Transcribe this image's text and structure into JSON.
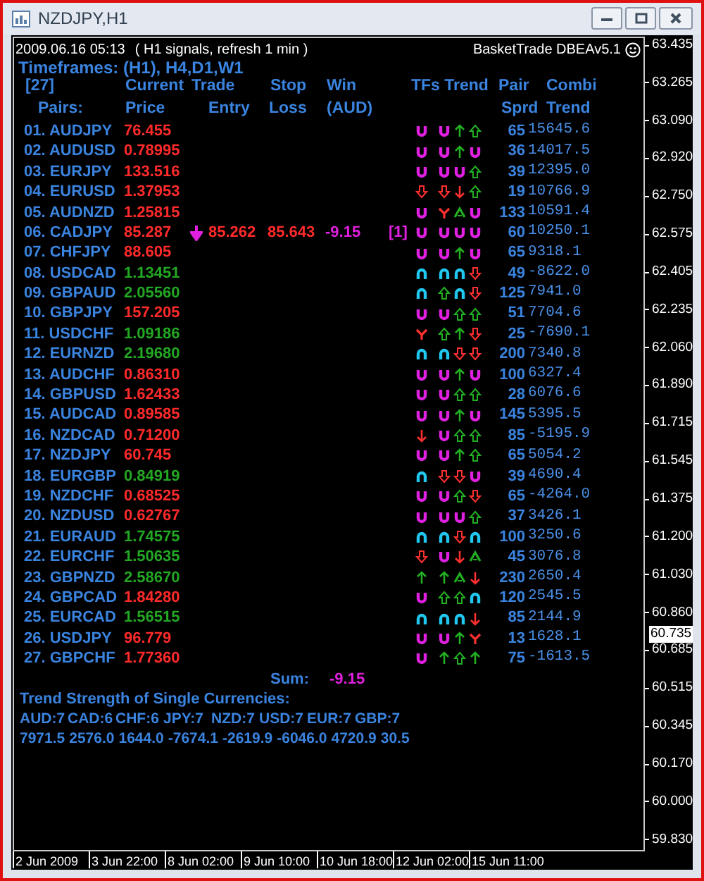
{
  "window": {
    "title": "NZDJPY,H1"
  },
  "chart": {
    "timestamp": "2009.06.16 05:13",
    "info": "( H1 signals, refresh 1 min )",
    "ea_name": "BasketTrade DBEAv5.1",
    "timeframes": "Timeframes: (H1), H4,D1,W1",
    "columns": [
      {
        "top": "[27]",
        "bottom": "Pairs:"
      },
      {
        "top": "Current",
        "bottom": "Price"
      },
      {
        "top": "Trade",
        "bottom": "Entry"
      },
      {
        "top": "Stop",
        "bottom": "Loss"
      },
      {
        "top": "Win",
        "bottom": "(AUD)"
      },
      {
        "top": "TFs Trend"
      },
      {
        "top": "Pair",
        "bottom": "Sprd"
      },
      {
        "top": "Combi",
        "bottom": "Trend"
      }
    ],
    "pairs": [
      {
        "label": "01. AUDJPY",
        "price": "76.455",
        "color": "#ff2a2a",
        "tf": {
          "kind": "cup"
        },
        "trend": [
          {
            "kind": "cup"
          },
          {
            "kind": "up"
          },
          {
            "kind": "hollowup"
          }
        ],
        "spread": "65",
        "combi": "15645.6"
      },
      {
        "label": "02. AUDUSD",
        "price": "0.78995",
        "color": "#ff2a2a",
        "tf": {
          "kind": "cup"
        },
        "trend": [
          {
            "kind": "cup"
          },
          {
            "kind": "up"
          },
          {
            "kind": "cup"
          }
        ],
        "spread": "36",
        "combi": "14017.5"
      },
      {
        "label": "03. EURJPY",
        "price": "133.516",
        "color": "#ff2a2a",
        "tf": {
          "kind": "cup"
        },
        "trend": [
          {
            "kind": "cup"
          },
          {
            "kind": "cup"
          },
          {
            "kind": "hollowup"
          }
        ],
        "spread": "39",
        "combi": "12395.0"
      },
      {
        "label": "04. EURUSD",
        "price": "1.37953",
        "color": "#ff2a2a",
        "tf": {
          "kind": "hollowdown"
        },
        "trend": [
          {
            "kind": "hollowdown"
          },
          {
            "kind": "down"
          },
          {
            "kind": "hollowup"
          }
        ],
        "spread": "19",
        "combi": "10766.9"
      },
      {
        "label": "05. AUDNZD",
        "price": "1.25815",
        "color": "#ff2a2a",
        "tf": {
          "kind": "cup"
        },
        "trend": [
          {
            "kind": "fork"
          },
          {
            "kind": "chevron"
          },
          {
            "kind": "cup"
          }
        ],
        "spread": "133",
        "combi": "10591.4"
      },
      {
        "label": "06. CADJPY",
        "price": "85.287",
        "color": "#ff2a2a",
        "trade": {
          "kind": "sell",
          "entry": "85.262",
          "stop": "85.643",
          "win": "-9.15",
          "count": "[1]"
        },
        "tf": {
          "kind": "cup"
        },
        "trend": [
          {
            "kind": "cup"
          },
          {
            "kind": "cup"
          },
          {
            "kind": "cup"
          }
        ],
        "spread": "60",
        "combi": "10250.1"
      },
      {
        "label": "07. CHFJPY",
        "price": "88.605",
        "color": "#ff2a2a",
        "tf": {
          "kind": "cup"
        },
        "trend": [
          {
            "kind": "cup"
          },
          {
            "kind": "up"
          },
          {
            "kind": "cup"
          }
        ],
        "spread": "65",
        "combi": "9318.1"
      },
      {
        "label": "08. USDCAD",
        "price": "1.13451",
        "color": "#22a822",
        "tf": {
          "kind": "arch"
        },
        "trend": [
          {
            "kind": "arch"
          },
          {
            "kind": "arch"
          },
          {
            "kind": "hollowdown"
          }
        ],
        "spread": "49",
        "combi": "-8622.0"
      },
      {
        "label": "09. GBPAUD",
        "price": "2.05560",
        "color": "#22a822",
        "tf": {
          "kind": "arch"
        },
        "trend": [
          {
            "kind": "hollowup"
          },
          {
            "kind": "arch"
          },
          {
            "kind": "hollowdown"
          }
        ],
        "spread": "125",
        "combi": "7941.0"
      },
      {
        "label": "10. GBPJPY",
        "price": "157.205",
        "color": "#ff2a2a",
        "tf": {
          "kind": "cup"
        },
        "trend": [
          {
            "kind": "cup"
          },
          {
            "kind": "hollowup"
          },
          {
            "kind": "hollowup"
          }
        ],
        "spread": "51",
        "combi": "7704.6"
      },
      {
        "label": "11. USDCHF",
        "price": "1.09186",
        "color": "#22a822",
        "tf": {
          "kind": "fork"
        },
        "trend": [
          {
            "kind": "hollowup"
          },
          {
            "kind": "up"
          },
          {
            "kind": "hollowdown"
          }
        ],
        "spread": "25",
        "combi": "-7690.1"
      },
      {
        "label": "12. EURNZD",
        "price": "2.19680",
        "color": "#22a822",
        "tf": {
          "kind": "arch"
        },
        "trend": [
          {
            "kind": "arch"
          },
          {
            "kind": "hollowdown"
          },
          {
            "kind": "hollowdown"
          }
        ],
        "spread": "200",
        "combi": "7340.8"
      },
      {
        "label": "13. AUDCHF",
        "price": "0.86310",
        "color": "#ff2a2a",
        "tf": {
          "kind": "cup"
        },
        "trend": [
          {
            "kind": "cup"
          },
          {
            "kind": "up"
          },
          {
            "kind": "cup"
          }
        ],
        "spread": "100",
        "combi": "6327.4"
      },
      {
        "label": "14. GBPUSD",
        "price": "1.62433",
        "color": "#ff2a2a",
        "tf": {
          "kind": "cup"
        },
        "trend": [
          {
            "kind": "cup"
          },
          {
            "kind": "hollowup"
          },
          {
            "kind": "hollowup"
          }
        ],
        "spread": "28",
        "combi": "6076.6"
      },
      {
        "label": "15. AUDCAD",
        "price": "0.89585",
        "color": "#ff2a2a",
        "tf": {
          "kind": "cup"
        },
        "trend": [
          {
            "kind": "cup"
          },
          {
            "kind": "up"
          },
          {
            "kind": "cup"
          }
        ],
        "spread": "145",
        "combi": "5395.5"
      },
      {
        "label": "16. NZDCAD",
        "price": "0.71200",
        "color": "#ff2a2a",
        "tf": {
          "kind": "down"
        },
        "trend": [
          {
            "kind": "cup"
          },
          {
            "kind": "hollowup"
          },
          {
            "kind": "hollowup"
          }
        ],
        "spread": "85",
        "combi": "-5195.9"
      },
      {
        "label": "17. NZDJPY",
        "price": "60.745",
        "color": "#ff2a2a",
        "tf": {
          "kind": "cup"
        },
        "trend": [
          {
            "kind": "cup"
          },
          {
            "kind": "up"
          },
          {
            "kind": "hollowup"
          }
        ],
        "spread": "65",
        "combi": "5054.2"
      },
      {
        "label": "18. EURGBP",
        "price": "0.84919",
        "color": "#22a822",
        "tf": {
          "kind": "arch"
        },
        "trend": [
          {
            "kind": "hollowdown"
          },
          {
            "kind": "hollowdown"
          },
          {
            "kind": "cup"
          }
        ],
        "spread": "39",
        "combi": "4690.4"
      },
      {
        "label": "19. NZDCHF",
        "price": "0.68525",
        "color": "#ff2a2a",
        "tf": {
          "kind": "cup"
        },
        "trend": [
          {
            "kind": "cup"
          },
          {
            "kind": "hollowup"
          },
          {
            "kind": "hollowdown"
          }
        ],
        "spread": "65",
        "combi": "-4264.0"
      },
      {
        "label": "20. NZDUSD",
        "price": "0.62767",
        "color": "#ff2a2a",
        "tf": {
          "kind": "cup"
        },
        "trend": [
          {
            "kind": "cup"
          },
          {
            "kind": "cup"
          },
          {
            "kind": "hollowup"
          }
        ],
        "spread": "37",
        "combi": "3426.1"
      },
      {
        "label": "21. EURAUD",
        "price": "1.74575",
        "color": "#22a822",
        "tf": {
          "kind": "arch"
        },
        "trend": [
          {
            "kind": "arch"
          },
          {
            "kind": "hollowdown"
          },
          {
            "kind": "arch"
          }
        ],
        "spread": "100",
        "combi": "3250.6"
      },
      {
        "label": "22. EURCHF",
        "price": "1.50635",
        "color": "#22a822",
        "tf": {
          "kind": "hollowdown"
        },
        "trend": [
          {
            "kind": "cup"
          },
          {
            "kind": "down"
          },
          {
            "kind": "chevron"
          }
        ],
        "spread": "45",
        "combi": "3076.8"
      },
      {
        "label": "23. GBPNZD",
        "price": "2.58670",
        "color": "#22a822",
        "tf": {
          "kind": "up"
        },
        "trend": [
          {
            "kind": "up"
          },
          {
            "kind": "chevron"
          },
          {
            "kind": "down"
          }
        ],
        "spread": "230",
        "combi": "2650.4"
      },
      {
        "label": "24. GBPCAD",
        "price": "1.84280",
        "color": "#ff2a2a",
        "tf": {
          "kind": "cup"
        },
        "trend": [
          {
            "kind": "hollowup"
          },
          {
            "kind": "hollowup"
          },
          {
            "kind": "arch"
          }
        ],
        "spread": "120",
        "combi": "2545.5"
      },
      {
        "label": "25. EURCAD",
        "price": "1.56515",
        "color": "#22a822",
        "tf": {
          "kind": "arch"
        },
        "trend": [
          {
            "kind": "arch"
          },
          {
            "kind": "arch"
          },
          {
            "kind": "down"
          }
        ],
        "spread": "85",
        "combi": "2144.9"
      },
      {
        "label": "26. USDJPY",
        "price": "96.779",
        "color": "#ff2a2a",
        "tf": {
          "kind": "cup"
        },
        "trend": [
          {
            "kind": "cup"
          },
          {
            "kind": "up"
          },
          {
            "kind": "fork"
          }
        ],
        "spread": "13",
        "combi": "1628.1"
      },
      {
        "label": "27. GBPCHF",
        "price": "1.77360",
        "color": "#ff2a2a",
        "tf": {
          "kind": "cup"
        },
        "trend": [
          {
            "kind": "up"
          },
          {
            "kind": "hollowup"
          },
          {
            "kind": "up"
          }
        ],
        "spread": "75",
        "combi": "-1613.5"
      }
    ],
    "sum": {
      "label": "Sum:",
      "value": "-9.15"
    },
    "strength": {
      "title": "Trend Strength of Single Currencies:",
      "currencies": [
        {
          "currency": "AUD:7",
          "value": "7971.5"
        },
        {
          "currency": "CAD:6",
          "value": "2576.0"
        },
        {
          "currency": "CHF:6",
          "value": "1644.0"
        },
        {
          "currency": "JPY:7",
          "value": "-7674.1"
        },
        {
          "currency": "NZD:7",
          "value": "-2619.9"
        },
        {
          "currency": "USD:7",
          "value": "-6046.0"
        },
        {
          "currency": "EUR:7",
          "value": "4720.9"
        },
        {
          "currency": "GBP:7",
          "value": "30.5"
        }
      ]
    }
  },
  "price_axis": {
    "ticks": [
      "63.435",
      "63.265",
      "63.090",
      "62.920",
      "62.750",
      "62.575",
      "62.405",
      "62.235",
      "62.060",
      "61.890",
      "61.715",
      "61.545",
      "61.375",
      "61.200",
      "61.030",
      "60.860",
      "60.685",
      "60.515",
      "60.345",
      "60.170",
      "60.000",
      "59.830"
    ],
    "current": "60.735"
  },
  "time_axis": [
    "2 Jun 2009",
    "3 Jun 22:00",
    "8 Jun 02:00",
    "9 Jun 10:00",
    "10 Jun 18:00",
    "12 Jun 02:00",
    "15 Jun 11:00"
  ]
}
